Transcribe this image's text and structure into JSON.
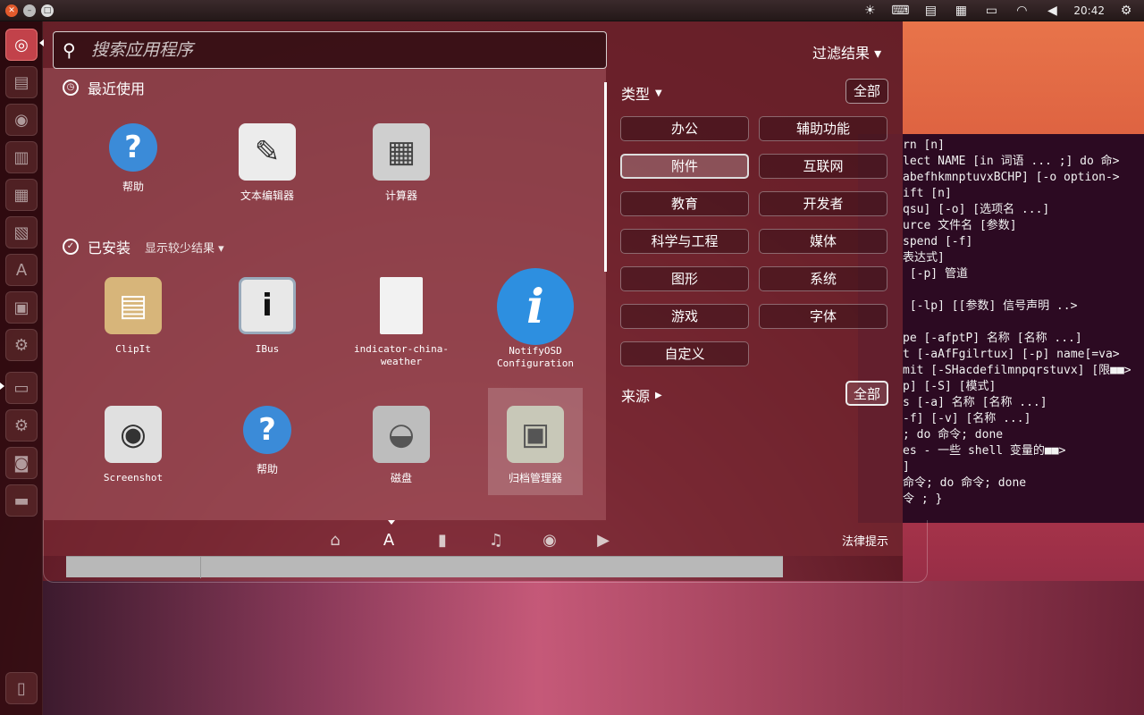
{
  "top_panel": {
    "clock": "20:42",
    "indicators": [
      {
        "name": "weather-icon",
        "glyph": "☀"
      },
      {
        "name": "keyboard-icon",
        "glyph": "⌨"
      },
      {
        "name": "files-icon",
        "glyph": "▤"
      },
      {
        "name": "calendar-icon",
        "glyph": "▦"
      },
      {
        "name": "battery-icon",
        "glyph": "▭"
      },
      {
        "name": "wifi-icon",
        "glyph": "◠"
      },
      {
        "name": "volume-icon",
        "glyph": "◀"
      },
      {
        "name": "settings-gear-icon",
        "glyph": "⚙"
      }
    ]
  },
  "search": {
    "placeholder": "搜索应用程序"
  },
  "filter_toggle": "过滤结果 ▾",
  "recent": {
    "title": "最近使用",
    "apps": [
      {
        "label": "帮助",
        "glyph": "?",
        "color": "#3b8bd8"
      },
      {
        "label": "文本编辑器",
        "glyph": "✎",
        "color": "#e8e8e8"
      },
      {
        "label": "计算器",
        "glyph": "▦",
        "color": "#cfcfcf"
      }
    ]
  },
  "installed": {
    "title": "已安装",
    "toggle": "显示较少结果 ▾",
    "apps": [
      {
        "label": "ClipIt",
        "glyph": "📋",
        "color": "#d7b57a"
      },
      {
        "label": "IBus",
        "glyph": "i",
        "color": "#e8e8e8"
      },
      {
        "label": "indicator-china-weather",
        "glyph": "",
        "color": "#f2f2f2"
      },
      {
        "label": "NotifyOSD Configuration",
        "glyph": "i",
        "color": "#2d8fe0"
      },
      {
        "label": "Screenshot",
        "glyph": "📷",
        "color": "#e0e0e0"
      },
      {
        "label": "帮助",
        "glyph": "?",
        "color": "#3b8bd8"
      },
      {
        "label": "磁盘",
        "glyph": "◒",
        "color": "#bdbdbd"
      },
      {
        "label": "归档管理器",
        "glyph": "▣",
        "color": "#c8c8b8"
      }
    ]
  },
  "filters": {
    "type_title": "类型",
    "type_all": "全部",
    "categories": [
      "办公",
      "辅助功能",
      "附件",
      "互联网",
      "教育",
      "开发者",
      "科学与工程",
      "媒体",
      "图形",
      "系统",
      "游戏",
      "字体",
      "自定义"
    ],
    "active_category": "附件",
    "source_title": "来源",
    "source_all": "全部"
  },
  "lenses": [
    {
      "name": "home-lens-icon",
      "glyph": "⌂"
    },
    {
      "name": "applications-lens-icon",
      "glyph": "A"
    },
    {
      "name": "files-lens-icon",
      "glyph": "▮"
    },
    {
      "name": "music-lens-icon",
      "glyph": "♫"
    },
    {
      "name": "photos-lens-icon",
      "glyph": "◉"
    },
    {
      "name": "video-lens-icon",
      "glyph": "▶"
    }
  ],
  "legal": "法律提示",
  "terminal_lines": [
    "rn [n]",
    "lect NAME [in 词语 ... ;] do 命>",
    "abefhkmnptuvxBCHP] [-o option->",
    "ift [n]",
    "qsu] [-o] [选项名 ...]",
    "urce 文件名 [参数]",
    "spend [-f]",
    "表达式]",
    " [-p] 管道",
    "",
    " [-lp] [[参数] 信号声明 ..>",
    "",
    "pe [-afptP] 名称 [名称 ...]",
    "t [-aAfFgilrtux] [-p] name[=va>",
    "mit [-SHacdefilmnpqrstuvx] [限■■>",
    "p] [-S] [模式]",
    "s [-a] 名称 [名称 ...]",
    "-f] [-v] [名称 ...]",
    "; do 命令; done",
    "es - 一些 shell 变量的■■>",
    "]",
    "命令; do 命令; done",
    "令 ; }"
  ]
}
